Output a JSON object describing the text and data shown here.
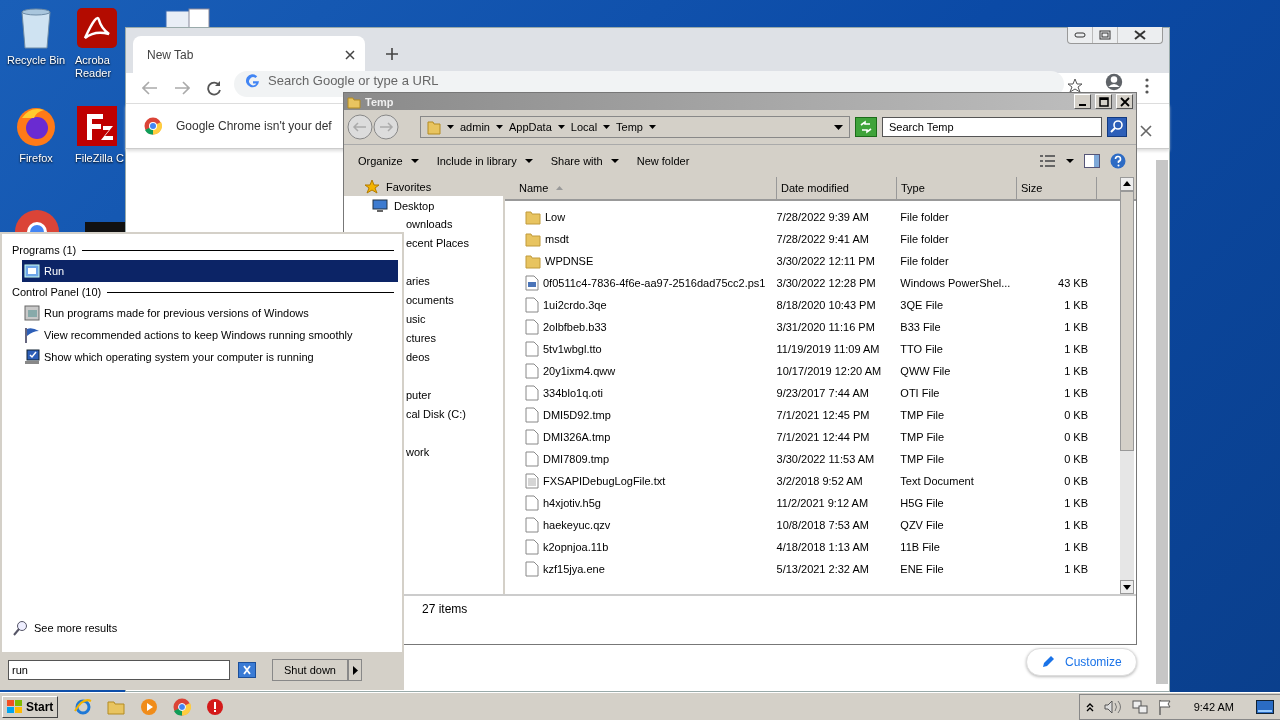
{
  "desktop_icons": [
    {
      "label": "Recycle Bin",
      "kind": "recycle"
    },
    {
      "label": "Acroba Reader",
      "kind": "acrobat"
    },
    {
      "label": "Firefox",
      "kind": "firefox"
    },
    {
      "label": "FileZilla C",
      "kind": "filezilla"
    }
  ],
  "browser": {
    "tabs": [
      {
        "label": "New Tab",
        "selected": true
      }
    ],
    "address_placeholder": "Search Google or type a URL",
    "infobar_text": "Google Chrome isn't your def",
    "customize_button": "Customize"
  },
  "explorer": {
    "title": "Temp",
    "breadcrumb": [
      "admin",
      "AppData",
      "Local",
      "Temp"
    ],
    "search_placeholder": "Search Temp",
    "commands": [
      {
        "label": "Organize",
        "dropdown": true
      },
      {
        "label": "Include in library",
        "dropdown": true
      },
      {
        "label": "Share with",
        "dropdown": true
      },
      {
        "label": "New folder",
        "dropdown": false
      }
    ],
    "sidebar": {
      "items": [
        {
          "label": "Favorites",
          "kind": "favorites",
          "selected": true
        },
        {
          "label": "Desktop",
          "kind": "desktop",
          "selected": false
        }
      ],
      "clipped_items": [
        "ownloads",
        "ecent Places",
        "aries",
        "ocuments",
        "usic",
        "ctures",
        "deos",
        "puter",
        "cal Disk (C:)",
        "work"
      ]
    },
    "columns": [
      "Name",
      "Date modified",
      "Type",
      "Size"
    ],
    "rows": [
      {
        "name": "Low",
        "date": "7/28/2022 9:39 AM",
        "type": "File folder",
        "size": "",
        "kind": "folder"
      },
      {
        "name": "msdt",
        "date": "7/28/2022 9:41 AM",
        "type": "File folder",
        "size": "",
        "kind": "folder"
      },
      {
        "name": "WPDNSE",
        "date": "3/30/2022 12:11 PM",
        "type": "File folder",
        "size": "",
        "kind": "folder"
      },
      {
        "name": "0f0511c4-7836-4f6e-aa97-2516dad75cc2.ps1",
        "date": "3/30/2022 12:28 PM",
        "type": "Windows PowerShel...",
        "size": "43 KB",
        "kind": "script"
      },
      {
        "name": "1ui2crdo.3qe",
        "date": "8/18/2020 10:43 PM",
        "type": "3QE File",
        "size": "1 KB",
        "kind": "file"
      },
      {
        "name": "2olbfbeb.b33",
        "date": "3/31/2020 11:16 PM",
        "type": "B33 File",
        "size": "1 KB",
        "kind": "file"
      },
      {
        "name": "5tv1wbgl.tto",
        "date": "11/19/2019 11:09 AM",
        "type": "TTO File",
        "size": "1 KB",
        "kind": "file"
      },
      {
        "name": "20y1ixm4.qww",
        "date": "10/17/2019 12:20 AM",
        "type": "QWW File",
        "size": "1 KB",
        "kind": "file"
      },
      {
        "name": "334blo1q.oti",
        "date": "9/23/2017 7:44 AM",
        "type": "OTI File",
        "size": "1 KB",
        "kind": "file"
      },
      {
        "name": "DMI5D92.tmp",
        "date": "7/1/2021 12:45 PM",
        "type": "TMP File",
        "size": "0 KB",
        "kind": "file"
      },
      {
        "name": "DMI326A.tmp",
        "date": "7/1/2021 12:44 PM",
        "type": "TMP File",
        "size": "0 KB",
        "kind": "file"
      },
      {
        "name": "DMI7809.tmp",
        "date": "3/30/2022 11:53 AM",
        "type": "TMP File",
        "size": "0 KB",
        "kind": "file"
      },
      {
        "name": "FXSAPIDebugLogFile.txt",
        "date": "3/2/2018 9:52 AM",
        "type": "Text Document",
        "size": "0 KB",
        "kind": "text"
      },
      {
        "name": "h4xjotiv.h5g",
        "date": "11/2/2021 9:12 AM",
        "type": "H5G File",
        "size": "1 KB",
        "kind": "file"
      },
      {
        "name": "haekeyuc.qzv",
        "date": "10/8/2018 7:53 AM",
        "type": "QZV File",
        "size": "1 KB",
        "kind": "file"
      },
      {
        "name": "k2opnjoa.11b",
        "date": "4/18/2018 1:13 AM",
        "type": "11B File",
        "size": "1 KB",
        "kind": "file"
      },
      {
        "name": "kzf15jya.ene",
        "date": "5/13/2021 2:32 AM",
        "type": "ENE File",
        "size": "1 KB",
        "kind": "file"
      }
    ],
    "status": "27 items"
  },
  "start_menu": {
    "groups": [
      {
        "heading": "Programs (1)",
        "items": [
          {
            "label": "Run",
            "kind": "run",
            "selected": true
          }
        ]
      },
      {
        "heading": "Control Panel (10)",
        "items": [
          {
            "label": "Run programs made for previous versions of Windows",
            "kind": "compat",
            "selected": false
          },
          {
            "label": "View recommended actions to keep Windows running smoothly",
            "kind": "flag",
            "selected": false
          },
          {
            "label": "Show which operating system your computer is running",
            "kind": "system",
            "selected": false
          }
        ]
      }
    ],
    "see_more": "See more results",
    "search_value": "run",
    "shutdown_button": "Shut down"
  },
  "taskbar": {
    "start_button": "Start",
    "apps": [
      {
        "kind": "ie"
      },
      {
        "kind": "explorer"
      },
      {
        "kind": "media"
      },
      {
        "kind": "chrome"
      },
      {
        "kind": "stop"
      }
    ],
    "clock": "9:42 AM"
  }
}
